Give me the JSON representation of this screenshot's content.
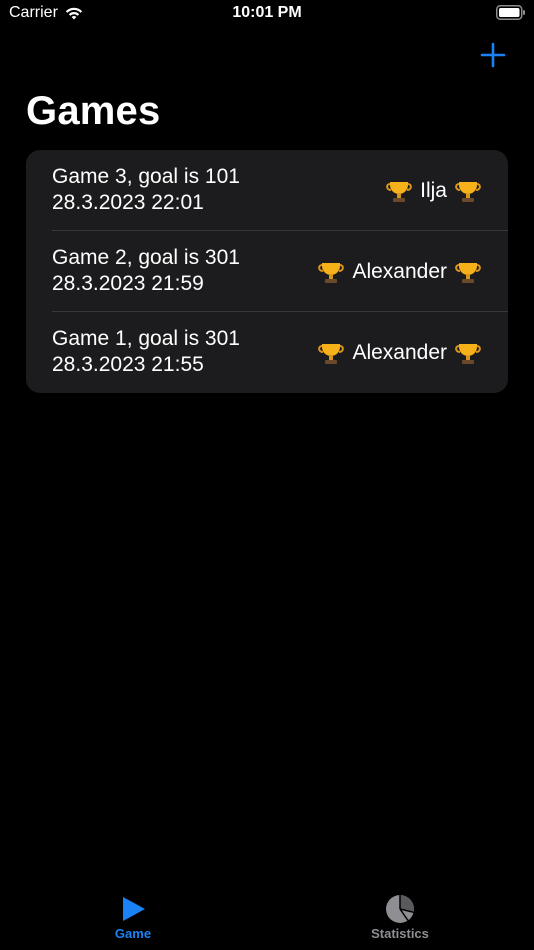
{
  "status_bar": {
    "carrier": "Carrier",
    "time": "10:01 PM"
  },
  "nav": {
    "add_icon": "plus-icon",
    "accent_color": "#1a82f5"
  },
  "page": {
    "title": "Games"
  },
  "games": [
    {
      "title": "Game 3, goal is 101",
      "date": "28.3.2023 22:01",
      "winner": "Ilja"
    },
    {
      "title": "Game 2, goal is 301",
      "date": "28.3.2023 21:59",
      "winner": "Alexander"
    },
    {
      "title": "Game 1, goal is 301",
      "date": "28.3.2023 21:55",
      "winner": "Alexander"
    }
  ],
  "trophy_icon": "trophy-icon",
  "tab_bar": {
    "tabs": [
      {
        "label": "Game",
        "icon": "play-icon",
        "selected": true
      },
      {
        "label": "Statistics",
        "icon": "pie-chart-icon",
        "selected": false
      }
    ]
  }
}
